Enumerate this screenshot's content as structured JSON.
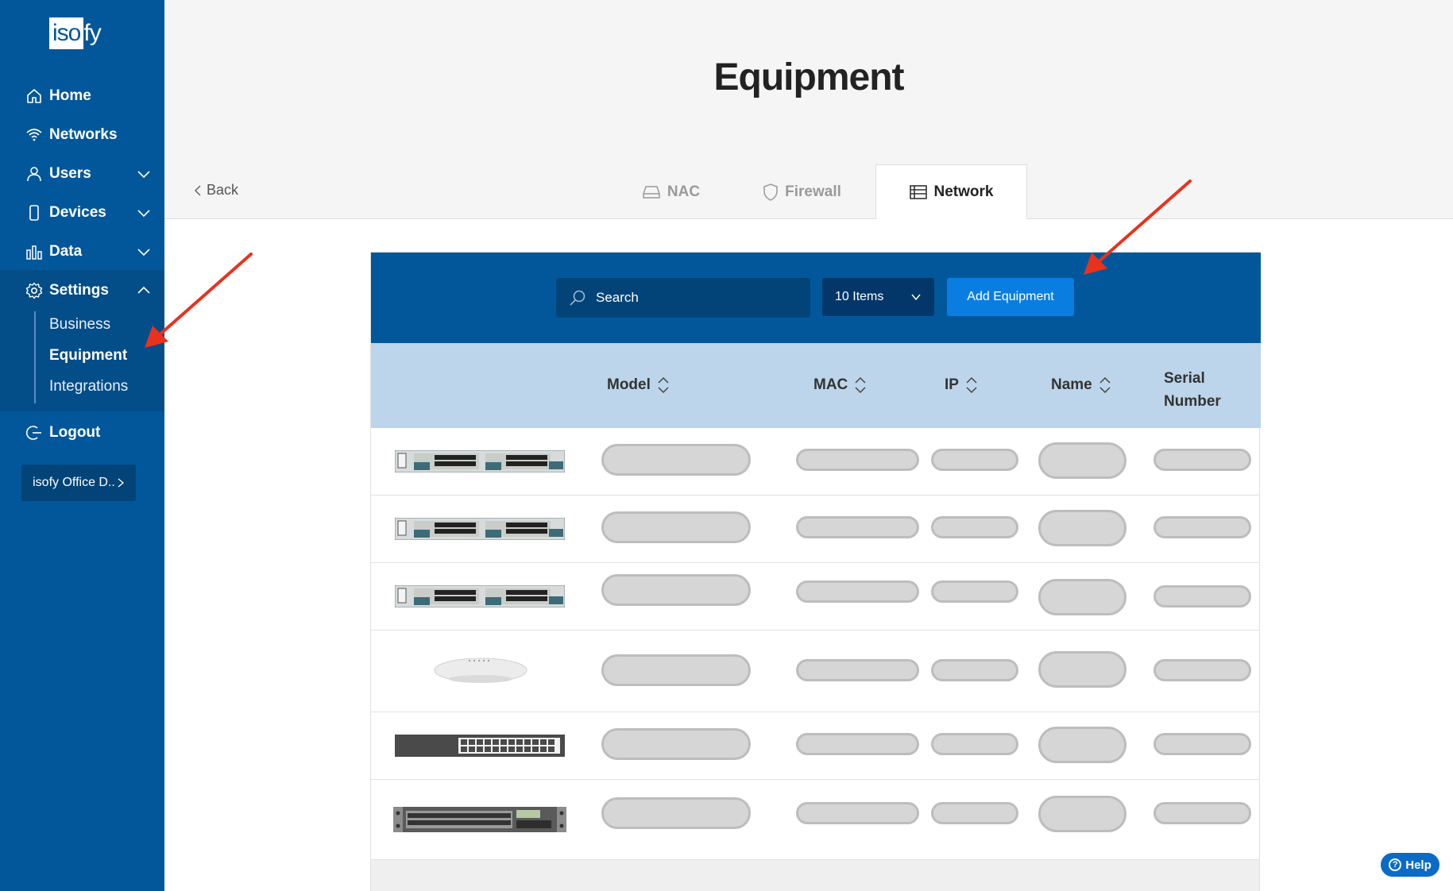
{
  "sidebar": {
    "logo": {
      "boxed": "iso",
      "rest": "fy"
    },
    "nav": {
      "home": "Home",
      "networks": "Networks",
      "users": "Users",
      "devices": "Devices",
      "data": "Data",
      "settings": "Settings",
      "logout": "Logout"
    },
    "settings_sub": {
      "business": "Business",
      "equipment": "Equipment",
      "integrations": "Integrations"
    },
    "org_button": "isofy Office D..",
    "active_item": "Equipment"
  },
  "header": {
    "title": "Equipment",
    "back_label": "Back"
  },
  "tabs": [
    {
      "label": "NAC",
      "icon": "hard-drive-icon",
      "active": false
    },
    {
      "label": "Firewall",
      "icon": "shield-icon",
      "active": false
    },
    {
      "label": "Network",
      "icon": "server-list-icon",
      "active": true
    }
  ],
  "toolbar": {
    "search_placeholder": "Search",
    "items_per_page": "10 Items",
    "add_button": "Add Equipment"
  },
  "table": {
    "columns": {
      "model": "Model",
      "mac": "MAC",
      "ip": "IP",
      "name": "Name",
      "serial_line1": "Serial",
      "serial_line2": "Number"
    },
    "rows": [
      {
        "device_type": "stacked-switch"
      },
      {
        "device_type": "stacked-switch"
      },
      {
        "device_type": "stacked-switch"
      },
      {
        "device_type": "access-point"
      },
      {
        "device_type": "dark-switch"
      },
      {
        "device_type": "rack-switch"
      }
    ]
  },
  "help": {
    "label": "Help"
  },
  "colors": {
    "sidebar": "#02579b",
    "toolbar": "#02579b",
    "table_header": "#bcd5ea",
    "add_button": "#0a7ee0",
    "annotation_arrow": "#e8321e"
  }
}
